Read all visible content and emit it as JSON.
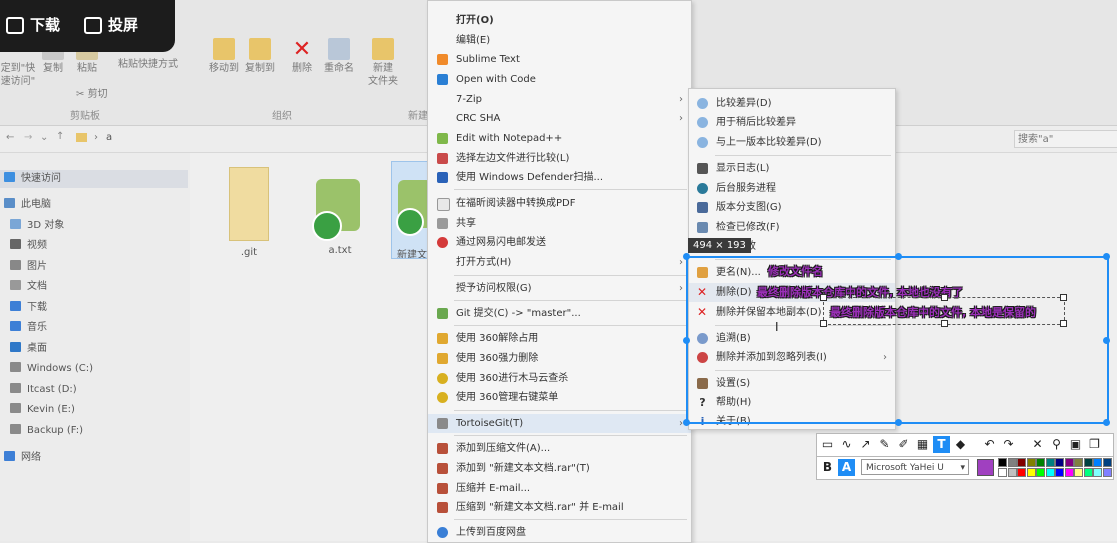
{
  "overlay": {
    "download_label": "下载",
    "cast_label": "投屏"
  },
  "ribbon": {
    "pin_quick_access": "定到\"快\n速访问\"",
    "copy": "复制",
    "paste": "粘贴",
    "paste_shortcut": "粘贴快捷方式",
    "cut": "剪切",
    "move_to": "移动到",
    "copy_to": "复制到",
    "delete": "删除",
    "rename": "重命名",
    "new_folder": "新建\n文件夹",
    "group_clipboard": "剪贴板",
    "group_organize": "组织",
    "group_new": "新建"
  },
  "address": {
    "path_sep": "a",
    "search_placeholder": "搜索\"a\""
  },
  "nav": {
    "items": [
      "快速访问",
      "此电脑",
      "3D 对象",
      "视频",
      "图片",
      "文档",
      "下载",
      "音乐",
      "桌面",
      "Windows (C:)",
      "Itcast (D:)",
      "Kevin (E:)",
      "Backup (F:)",
      "网络"
    ]
  },
  "files": [
    {
      "name": ".git"
    },
    {
      "name": "a.txt"
    },
    {
      "name": "新建文"
    }
  ],
  "context_menu": {
    "items": [
      {
        "label": "打开(O)",
        "bold": true
      },
      {
        "label": "编辑(E)"
      },
      {
        "label": "Sublime Text"
      },
      {
        "label": "Open with Code"
      },
      {
        "label": "7-Zip",
        "submenu": true
      },
      {
        "label": "CRC SHA",
        "submenu": true
      },
      {
        "label": "Edit with Notepad++"
      },
      {
        "label": "选择左边文件进行比较(L)"
      },
      {
        "label": "使用 Windows Defender扫描..."
      },
      {
        "label": "在福昕阅读器中转换成PDF"
      },
      {
        "label": "共享"
      },
      {
        "label": "通过网易闪电邮发送"
      },
      {
        "label": "打开方式(H)",
        "submenu": true
      },
      {
        "label": "授予访问权限(G)",
        "submenu": true
      },
      {
        "label": "Git 提交(C) -> \"master\"..."
      },
      {
        "label": "使用 360解除占用"
      },
      {
        "label": "使用 360强力删除"
      },
      {
        "label": "使用 360进行木马云查杀"
      },
      {
        "label": "使用 360管理右键菜单"
      },
      {
        "label": "TortoiseGit(T)",
        "submenu": true
      },
      {
        "label": "添加到压缩文件(A)..."
      },
      {
        "label": "添加到 \"新建文本文档.rar\"(T)"
      },
      {
        "label": "压缩并 E-mail..."
      },
      {
        "label": "压缩到 \"新建文本文档.rar\" 并 E-mail"
      },
      {
        "label": "上传到百度网盘"
      }
    ]
  },
  "sub_menu": {
    "items": [
      {
        "label": "比较差异(D)"
      },
      {
        "label": "用于稍后比较差异"
      },
      {
        "label": "与上一版本比较差异(D)"
      },
      {
        "label": "显示日志(L)"
      },
      {
        "label": "后台服务进程"
      },
      {
        "label": "版本分支图(G)"
      },
      {
        "label": "检查已修改(F)"
      },
      {
        "label": "提交更改"
      },
      {
        "label": "更名(N)..."
      },
      {
        "label": "删除(D)"
      },
      {
        "label": "删除并保留本地副本(D)"
      },
      {
        "label": "追溯(B)"
      },
      {
        "label": "删除并添加到忽略列表(I)",
        "submenu": true
      },
      {
        "label": "设置(S)"
      },
      {
        "label": "帮助(H)"
      },
      {
        "label": "关于(B)"
      }
    ]
  },
  "screenshot_tool": {
    "size_readout": "494 × 193",
    "annotations": [
      "修改文件名",
      "最终删除版本仓库中的文件, 本地也没有了",
      "最终删除版本仓库中的文件, 本地是保留的"
    ],
    "font_name": "Microsoft YaHei U",
    "selected_color": "#a040c0",
    "palette": [
      "#000000",
      "#808080",
      "#800000",
      "#808000",
      "#008000",
      "#008080",
      "#000080",
      "#800080",
      "#808040",
      "#004040",
      "#0080ff",
      "#004080",
      "#ffffff",
      "#c0c0c0",
      "#ff0000",
      "#ffff00",
      "#00ff00",
      "#00ffff",
      "#0000ff",
      "#ff00ff",
      "#ffff80",
      "#00ff80",
      "#80ffff",
      "#8080ff"
    ]
  },
  "colors": {
    "accent": "#1f8df5",
    "annotation": "#9b2fb8"
  }
}
